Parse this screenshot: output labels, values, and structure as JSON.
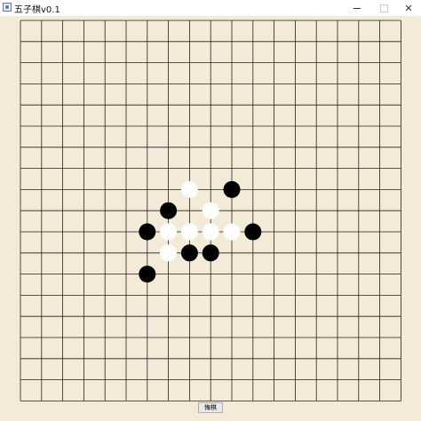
{
  "window": {
    "title": "五子棋v0.1",
    "min_glyph": "–",
    "close_glyph": "✕"
  },
  "board": {
    "lines": 18,
    "background": "#f3ead8",
    "line_color": "#222222",
    "stones": [
      {
        "color": "white",
        "col": 8,
        "row": 8
      },
      {
        "color": "black",
        "col": 10,
        "row": 8
      },
      {
        "color": "black",
        "col": 7,
        "row": 9
      },
      {
        "color": "white",
        "col": 9,
        "row": 9
      },
      {
        "color": "black",
        "col": 6,
        "row": 10
      },
      {
        "color": "white",
        "col": 7,
        "row": 10
      },
      {
        "color": "white",
        "col": 8,
        "row": 10
      },
      {
        "color": "white",
        "col": 9,
        "row": 10
      },
      {
        "color": "white",
        "col": 10,
        "row": 10
      },
      {
        "color": "black",
        "col": 11,
        "row": 10
      },
      {
        "color": "white",
        "col": 7,
        "row": 11
      },
      {
        "color": "black",
        "col": 8,
        "row": 11
      },
      {
        "color": "black",
        "col": 9,
        "row": 11
      },
      {
        "color": "black",
        "col": 6,
        "row": 12
      }
    ]
  },
  "controls": {
    "action_button_label": "悔棋"
  }
}
